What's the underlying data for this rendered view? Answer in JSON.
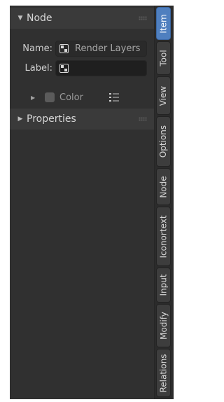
{
  "sections": {
    "node": {
      "title": "Node",
      "expanded": true
    },
    "properties": {
      "title": "Properties",
      "expanded": false
    }
  },
  "fields": {
    "name": {
      "label": "Name:",
      "value": "Render Layers"
    },
    "label": {
      "label": "Label:",
      "value": ""
    }
  },
  "color_row": {
    "label": "Color",
    "checked": false
  },
  "tabs": [
    {
      "label": "Item",
      "active": true
    },
    {
      "label": "Tool",
      "active": false
    },
    {
      "label": "View",
      "active": false
    },
    {
      "label": "Options",
      "active": false
    },
    {
      "label": "Node",
      "active": false
    },
    {
      "label": "Iconortext",
      "active": false
    },
    {
      "label": "Input",
      "active": false
    },
    {
      "label": "Modify",
      "active": false
    },
    {
      "label": "Relations",
      "active": false
    }
  ],
  "colors": {
    "active_tab": "#4f7fbf",
    "panel_bg": "#303030"
  },
  "icons": {
    "node_icon": "node-icon",
    "list_icon": "list-icon",
    "drag_handle": "drag-handle-icon"
  }
}
